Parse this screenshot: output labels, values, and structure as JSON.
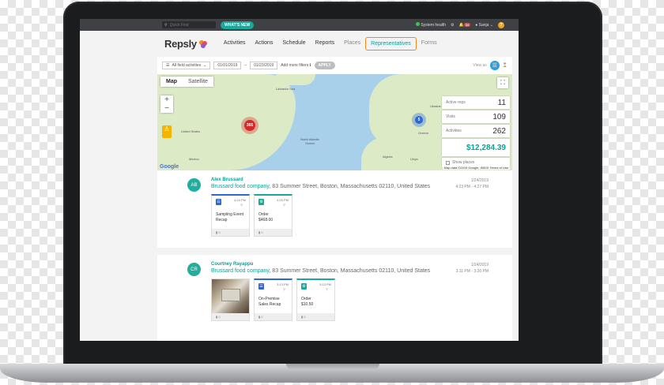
{
  "topbar": {
    "search_placeholder": "Quick Find",
    "whats_new": "WHAT'S NEW",
    "system_health": "System health",
    "notification_count": "34",
    "user_name": "Sanja",
    "help": "?"
  },
  "nav": {
    "logo": "Repsly",
    "items": [
      "Activities",
      "Actions",
      "Schedule",
      "Reports",
      "Places",
      "Representatives",
      "Forms"
    ],
    "active_index": 5
  },
  "filters": {
    "activity_type": "All field activities",
    "date_from": "01/01/2019",
    "date_to": "01/23/2019",
    "add_filters": "Add more filters",
    "apply": "APPLY",
    "view_as": "View as"
  },
  "map": {
    "tab_map": "Map",
    "tab_satellite": "Satellite",
    "cluster_na": "365",
    "cluster_eu": "5",
    "labels": {
      "ocean": "North Atlantic Ocean",
      "labrador_sea": "Labrador Sea",
      "united_states": "United States",
      "mexico": "Mexico",
      "algeria": "Algeria",
      "libya": "Libya",
      "greece": "Greece",
      "ukraine": "Ukraine"
    },
    "credit": "Map data ©2019 Google, INEGI   Terms of Use",
    "brand": "Google",
    "stats": {
      "active_reps_label": "Active reps",
      "active_reps": "11",
      "visits_label": "Visits",
      "visits": "109",
      "activities_label": "Activities",
      "activities": "262",
      "total": "$12,284.39",
      "show_places": "Show places"
    }
  },
  "activities": [
    {
      "initials": "AB",
      "rep": "Alex Brussard",
      "place": "Brussard food company",
      "address": ", 83 Summer Street, Boston, Massachusetts 02110, United States",
      "date": "1/24/2019",
      "time_range": "4:23 PM - 4:27 PM",
      "tiles": [
        {
          "kind": "form",
          "time": "4:24 PM",
          "title": "Sampling Event Recap",
          "comments": "0"
        },
        {
          "kind": "order",
          "time": "4:25 PM",
          "title": "Order",
          "amount": "$468.00",
          "comments": "0"
        }
      ]
    },
    {
      "initials": "CR",
      "rep": "Courtney Rayappu",
      "place": "Brussard food company",
      "address": ", 83 Summer Street, Boston, Massachusetts 02110, United States",
      "date": "1/24/2019",
      "time_range": "3:11 PM - 3:20 PM",
      "photo_comments": "0",
      "tiles": [
        {
          "kind": "form",
          "time": "3:13 PM",
          "title": "On-Premise Sales Recap",
          "comments": "0"
        },
        {
          "kind": "order",
          "time": "3:13 PM",
          "title": "Order",
          "amount": "$10.50",
          "comments": "0"
        }
      ]
    }
  ]
}
